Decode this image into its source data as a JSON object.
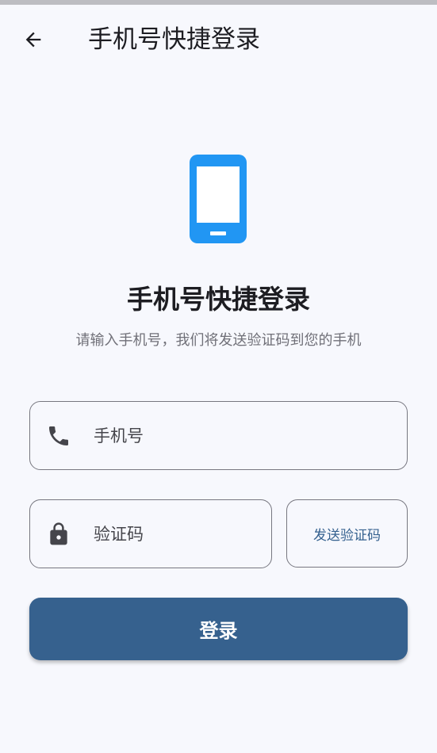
{
  "app_bar": {
    "title": "手机号快捷登录",
    "back_icon": "arrow-left-icon"
  },
  "hero": {
    "icon": "smartphone-icon",
    "icon_color": "#2196f3",
    "title": "手机号快捷登录",
    "subtitle": "请输入手机号，我们将发送验证码到您的手机"
  },
  "phone_field": {
    "icon": "phone-icon",
    "placeholder": "手机号",
    "value": ""
  },
  "code_field": {
    "icon": "lock-icon",
    "placeholder": "验证码",
    "value": ""
  },
  "send_code_button": {
    "label": "发送验证码"
  },
  "login_button": {
    "label": "登录",
    "color": "#36618e"
  }
}
